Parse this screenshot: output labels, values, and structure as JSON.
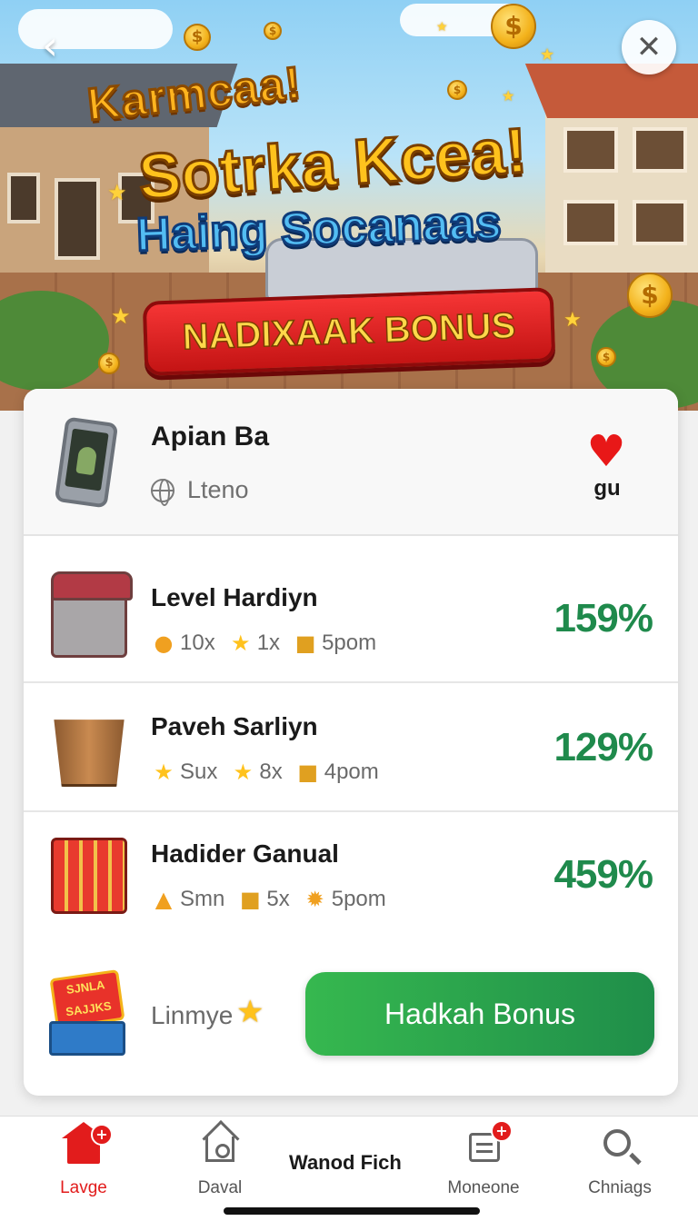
{
  "hero": {
    "title_line1": "Karmcaa!",
    "title_line2": "Sotrka Kcea!",
    "title_line3": "Haing Socanaas",
    "banner": "NADIXAAK BONUS",
    "coin_symbol": "$"
  },
  "header": {
    "title": "Apian Ba",
    "subtitle": "Lteno",
    "likes_count": "gu"
  },
  "offers": [
    {
      "name": "Level Hardiyn",
      "meta": [
        {
          "icon": "coin-icon",
          "value": "10x"
        },
        {
          "icon": "star-icon",
          "value": "1x"
        },
        {
          "icon": "box-icon",
          "value": "5pom"
        }
      ],
      "percent": "159%"
    },
    {
      "name": "Paveh Sarliyn",
      "meta": [
        {
          "icon": "star-icon",
          "value": "Sux"
        },
        {
          "icon": "star-icon",
          "value": "8x"
        },
        {
          "icon": "box-icon",
          "value": "4pom"
        }
      ],
      "percent": "129%"
    },
    {
      "name": "Hadider Ganual",
      "meta": [
        {
          "icon": "ticket-icon",
          "value": "Smn"
        },
        {
          "icon": "box-icon",
          "value": "5x"
        },
        {
          "icon": "sun-icon",
          "value": "5pom"
        }
      ],
      "percent": "459%"
    }
  ],
  "action": {
    "promo_text": "SJNLA SAJJKS",
    "limit_label": "Linmye",
    "button_label": "Hadkah Bonus"
  },
  "nav": {
    "items": [
      {
        "label": "Lavge",
        "active": true
      },
      {
        "label": "Daval"
      },
      {
        "label": "Wanod Fich"
      },
      {
        "label": "Moneone"
      },
      {
        "label": "Chniags"
      }
    ],
    "badge_symbol": "+"
  },
  "colors": {
    "accent_green": "#1f8a4c",
    "button_green": "#36b84f",
    "nav_active_red": "#e21c1c",
    "banner_red": "#e22626",
    "title_gold": "#ffc21d"
  }
}
